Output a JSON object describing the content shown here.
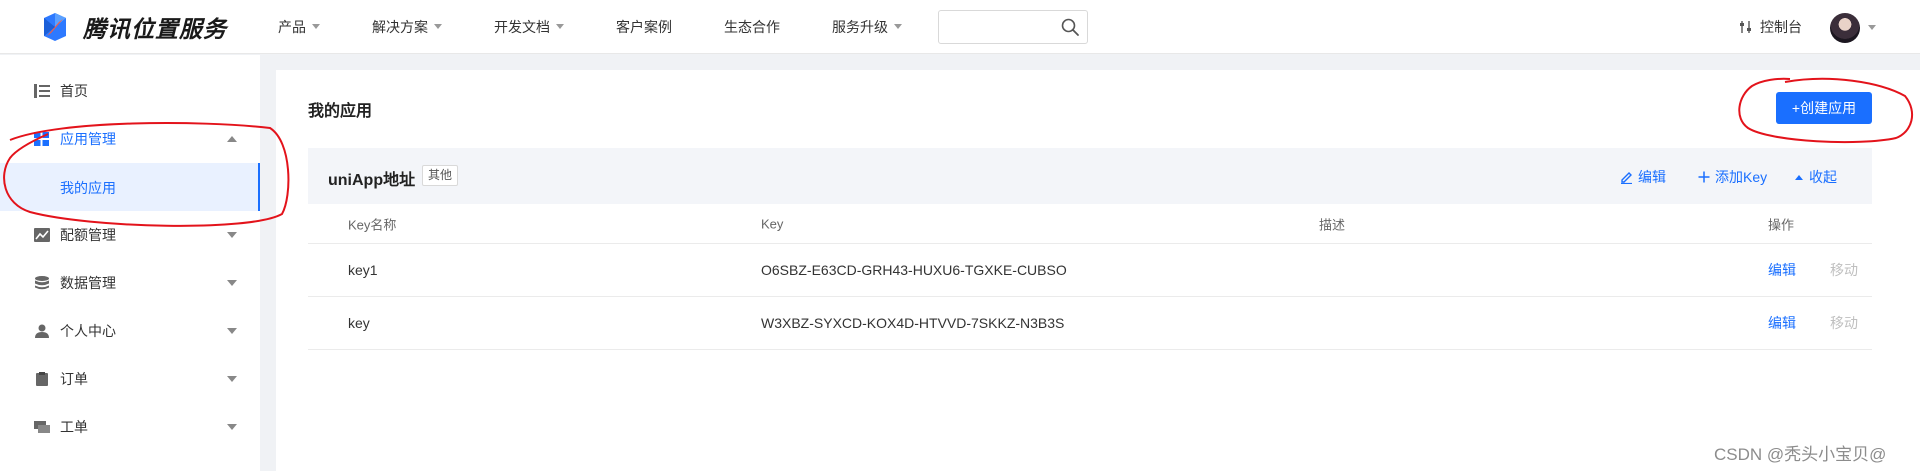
{
  "header": {
    "logo_text": "腾讯位置服务",
    "nav": [
      {
        "label": "产品",
        "has_dropdown": true
      },
      {
        "label": "解决方案",
        "has_dropdown": true
      },
      {
        "label": "开发文档",
        "has_dropdown": true
      },
      {
        "label": "客户案例",
        "has_dropdown": false
      },
      {
        "label": "生态合作",
        "has_dropdown": false
      },
      {
        "label": "服务升级",
        "has_dropdown": true
      }
    ],
    "search": {
      "value": "",
      "placeholder": ""
    },
    "console_label": "控制台"
  },
  "sidebar": {
    "items": [
      {
        "label": "首页",
        "icon": "list-icon"
      },
      {
        "label": "应用管理",
        "icon": "grid-icon",
        "expanded": true
      },
      {
        "label": "我的应用",
        "sub": true,
        "active": true
      },
      {
        "label": "配额管理",
        "icon": "chart-icon"
      },
      {
        "label": "数据管理",
        "icon": "database-icon"
      },
      {
        "label": "个人中心",
        "icon": "user-icon"
      },
      {
        "label": "订单",
        "icon": "clipboard-icon"
      },
      {
        "label": "工单",
        "icon": "ticket-icon"
      }
    ]
  },
  "main": {
    "title": "我的应用",
    "create_button": "+创建应用",
    "app": {
      "name": "uniApp地址",
      "tag": "其他",
      "actions": {
        "edit": "编辑",
        "add_key": "添加Key",
        "collapse": "收起"
      }
    },
    "table": {
      "headers": {
        "name": "Key名称",
        "key": "Key",
        "desc": "描述",
        "op": "操作"
      },
      "rows": [
        {
          "name": "key1",
          "key": "O6SBZ-E63CD-GRH43-HUXU6-TGXKE-CUBSO",
          "desc": "",
          "edit": "编辑",
          "move": "移动"
        },
        {
          "name": "key",
          "key": "W3XBZ-SYXCD-KOX4D-HTVVD-7SKKZ-N3B3S",
          "desc": "",
          "edit": "编辑",
          "move": "移动"
        }
      ]
    }
  },
  "watermark": "CSDN @秃头小宝贝@",
  "colors": {
    "accent": "#1a6fff",
    "annotation": "#e3131b"
  }
}
